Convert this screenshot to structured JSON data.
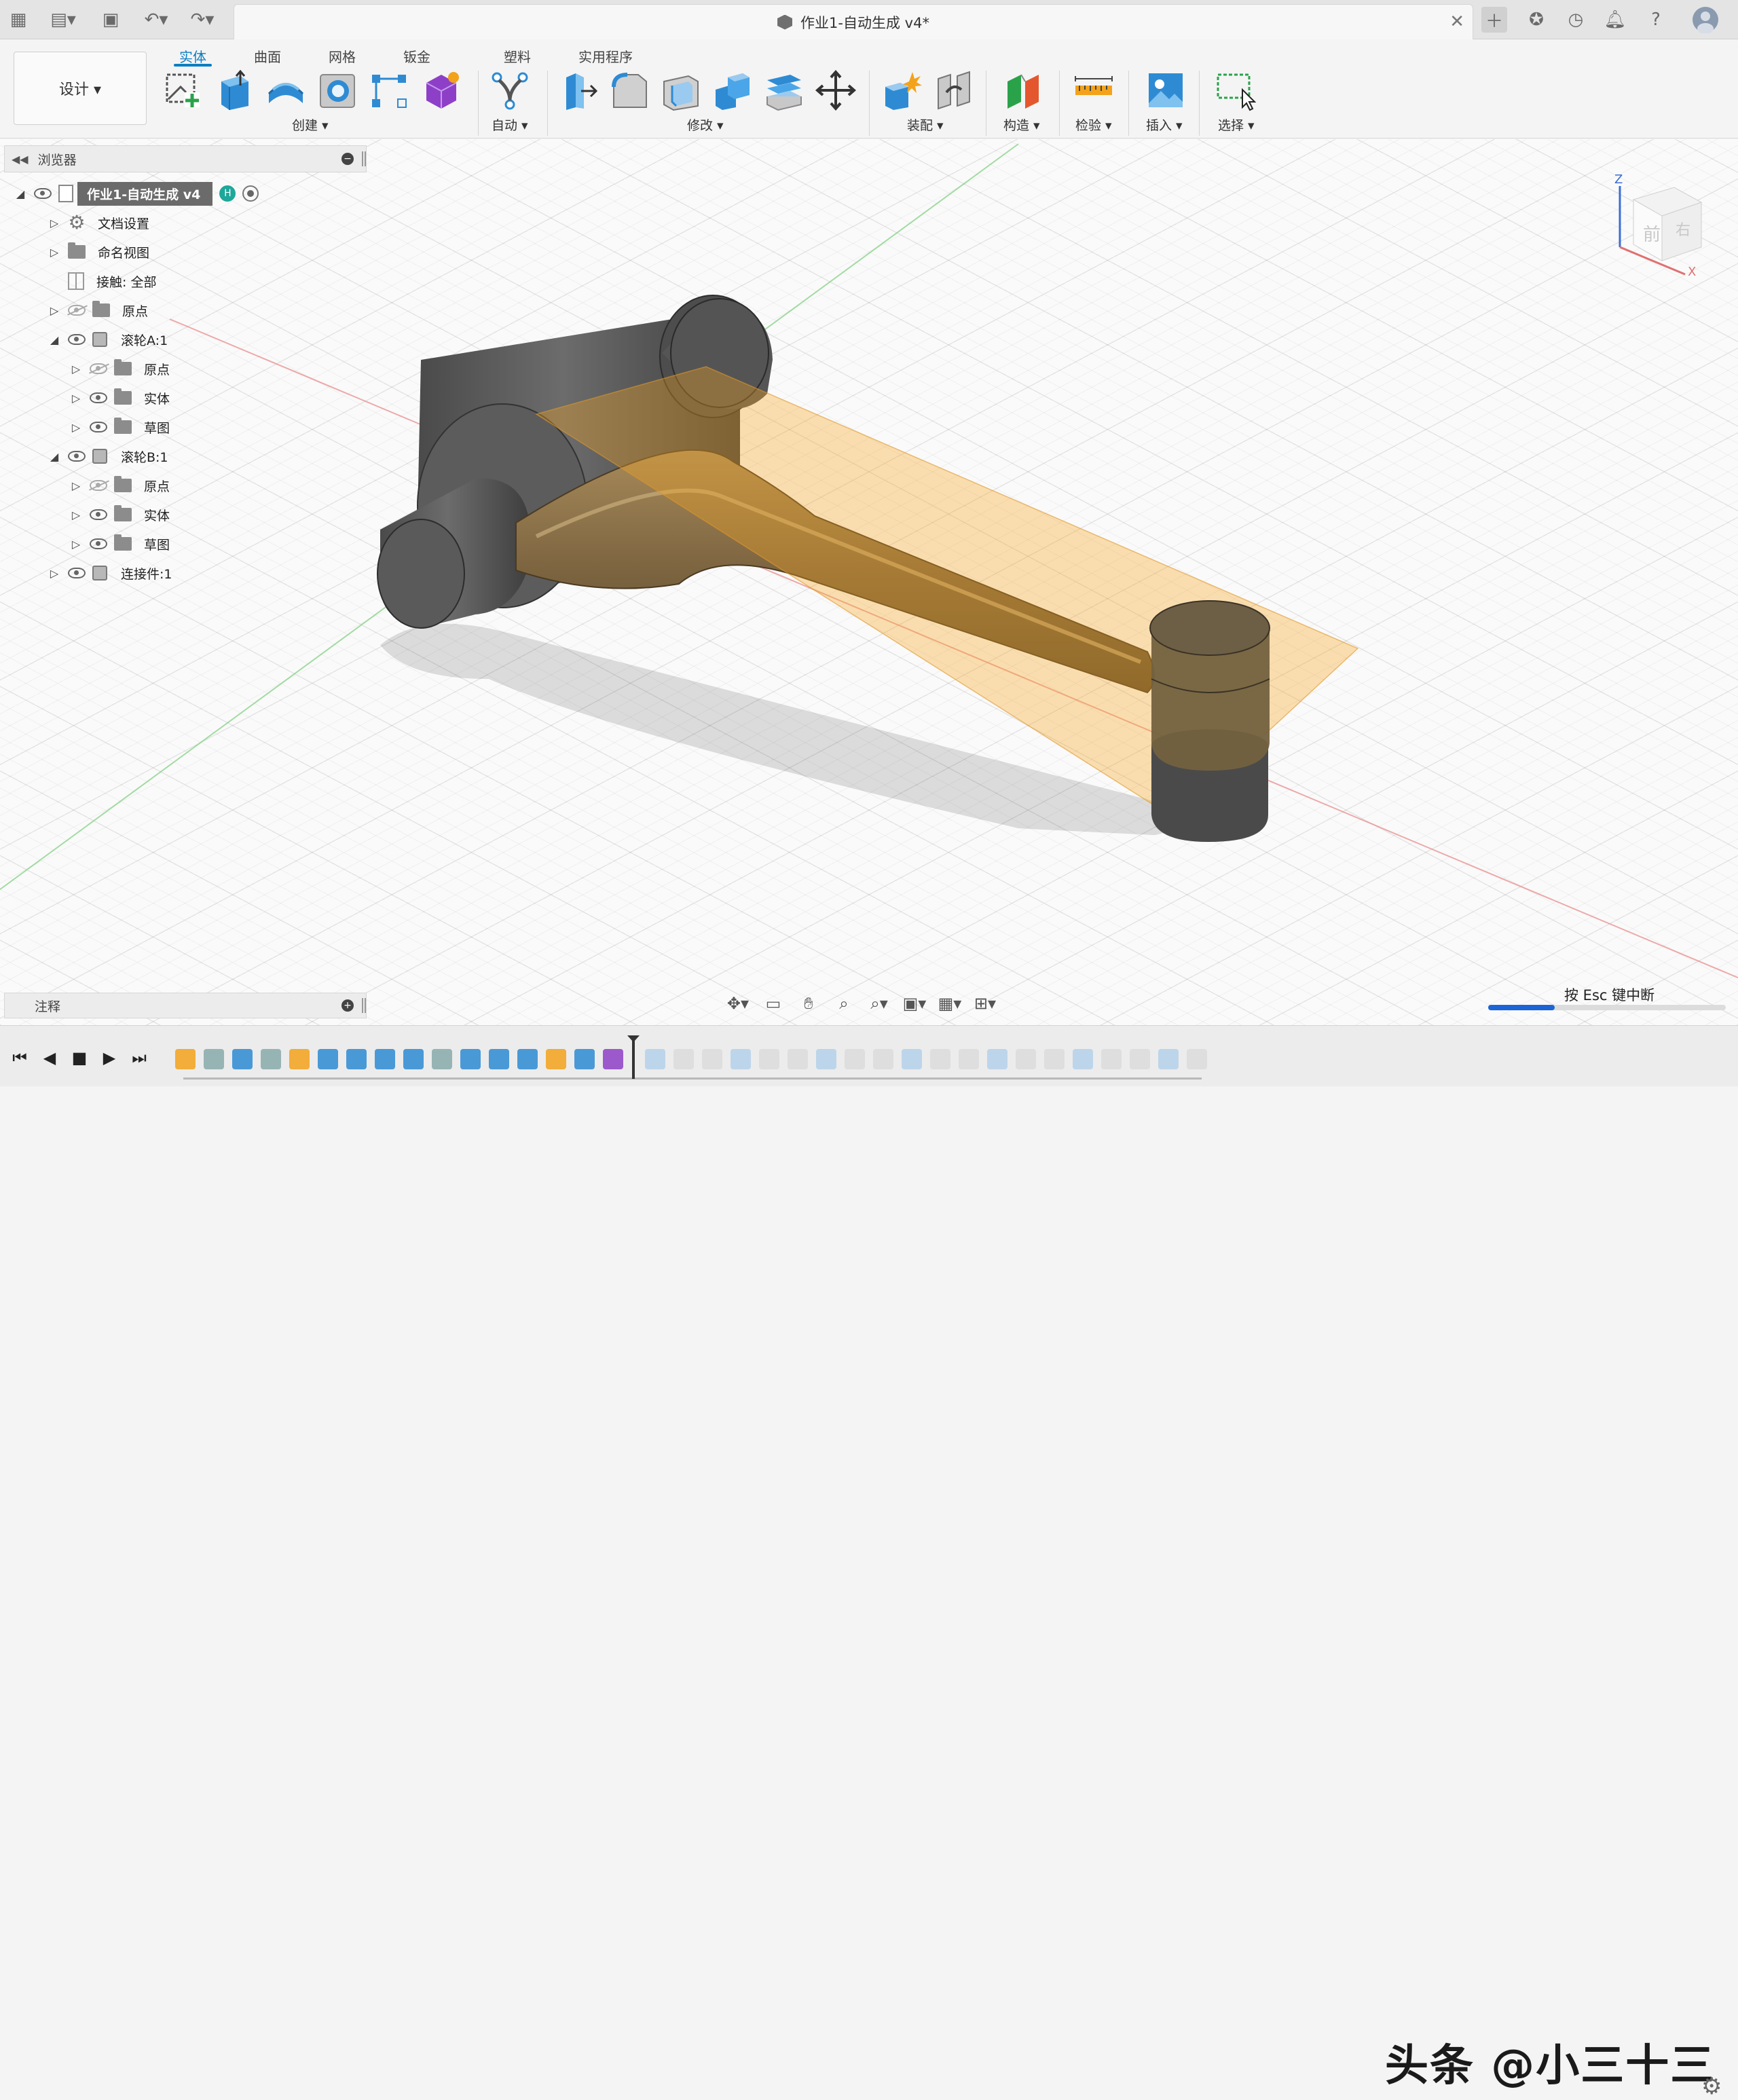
{
  "app_bar": {
    "doc_title": "作业1-自动生成 v4*"
  },
  "toolbar": {
    "workspace_label": "设计 ▾",
    "tabs": [
      "实体",
      "曲面",
      "网格",
      "钣金",
      "塑料",
      "实用程序"
    ],
    "groups": {
      "create": "创建 ▾",
      "automate": "自动 ▾",
      "modify": "修改 ▾",
      "assemble": "装配 ▾",
      "construct": "构造 ▾",
      "inspect": "检验 ▾",
      "insert": "插入 ▾",
      "select": "选择 ▾"
    }
  },
  "browser": {
    "title": "浏览器",
    "root": "作业1-自动生成 v4",
    "items": [
      {
        "label": "文档设置"
      },
      {
        "label": "命名视图"
      },
      {
        "label": "接触: 全部"
      },
      {
        "label": "原点"
      },
      {
        "label": "滚轮A:1"
      },
      {
        "label": "原点"
      },
      {
        "label": "实体"
      },
      {
        "label": "草图"
      },
      {
        "label": "滚轮B:1"
      },
      {
        "label": "原点"
      },
      {
        "label": "实体"
      },
      {
        "label": "草图"
      },
      {
        "label": "连接件:1"
      }
    ]
  },
  "comments_panel": {
    "title": "注释"
  },
  "status": {
    "esc_hint": "按 Esc 键中断",
    "progress": 0.28
  },
  "watermark": "头条 @小三十三",
  "viewcube": {
    "face_label": "前",
    "side_label": "右",
    "axis_z": "Z",
    "axis_x": "X"
  },
  "colors": {
    "accent": "#0a7ec2",
    "active_body": "#d99a3b",
    "body_gray": "#5a5a5a"
  }
}
